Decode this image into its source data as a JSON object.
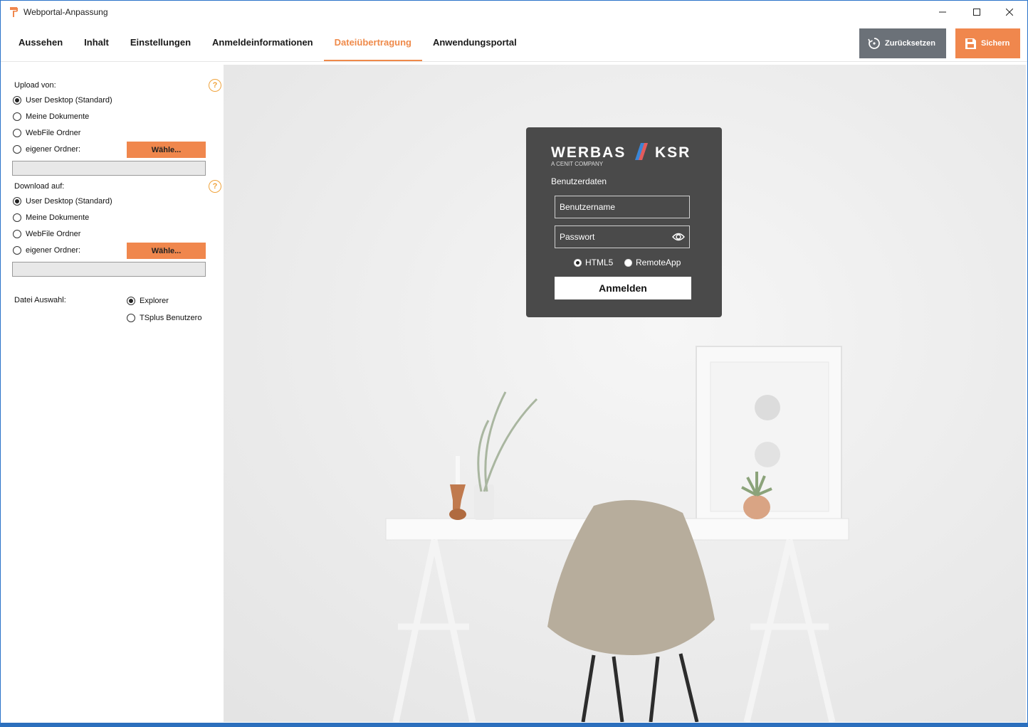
{
  "window": {
    "title": "Webportal-Anpassung"
  },
  "tabs": [
    {
      "label": "Aussehen"
    },
    {
      "label": "Inhalt"
    },
    {
      "label": "Einstellungen"
    },
    {
      "label": "Anmeldeinformationen"
    },
    {
      "label": "Dateiübertragung",
      "active": true
    },
    {
      "label": "Anwendungsportal"
    }
  ],
  "actions": {
    "reset_label": "Zurücksetzen",
    "save_label": "Sichern"
  },
  "colors": {
    "accent": "#f0874d",
    "reset_bg": "#6b7178",
    "card_bg": "#4a4a4a",
    "window_border": "#2a73c9"
  },
  "upload": {
    "label": "Upload von:",
    "options": [
      "User Desktop (Standard)",
      "Meine Dokumente",
      "WebFile Ordner",
      "eigener Ordner:"
    ],
    "selected": "User Desktop (Standard)",
    "choose_label": "Wähle...",
    "path_value": ""
  },
  "download": {
    "label": "Download auf:",
    "options": [
      "User Desktop (Standard)",
      "Meine Dokumente",
      "WebFile Ordner",
      "eigener Ordner:"
    ],
    "selected": "User Desktop (Standard)",
    "choose_label": "Wähle...",
    "path_value": ""
  },
  "file_selection": {
    "label": "Datei Auswahl:",
    "options": [
      "Explorer",
      "TSplus Benutzero"
    ],
    "selected": "Explorer"
  },
  "help_icon": "?",
  "preview": {
    "logo_left": "WERBAS",
    "logo_right": "KSR",
    "logo_sub": "A CENIT COMPANY",
    "section_title": "Benutzerdaten",
    "username_placeholder": "Benutzername",
    "password_placeholder": "Passwort",
    "modes": [
      "HTML5",
      "RemoteApp"
    ],
    "selected_mode": "HTML5",
    "login_label": "Anmelden"
  }
}
